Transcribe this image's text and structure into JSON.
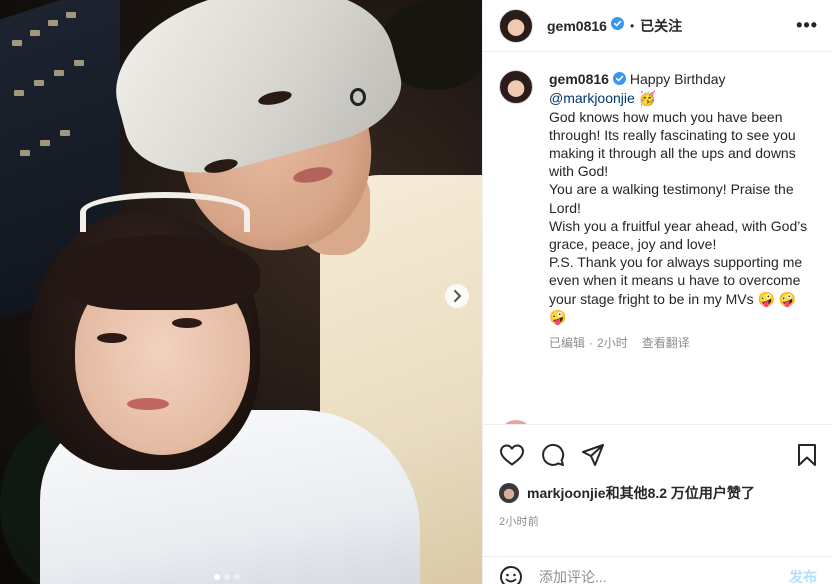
{
  "post": {
    "username": "gem0816",
    "follow_status": "已关注",
    "more_label": "•••",
    "separator": "•"
  },
  "caption": {
    "username": "gem0816",
    "intro": "Happy Birthday ",
    "mention": "@markjoonjie",
    "emoji_party": "🥳",
    "lines": [
      "God knows how much you have been through! Its really fascinating to see you making it through all the ups and downs with God!",
      "You are a walking testimony! Praise the Lord!",
      "Wish you a fruitful year ahead, with God’s grace, peace, joy and love!",
      "P.S. Thank you for always supporting me even when it means u have to overcome your stage fright to be in my MVs 🤪 🤪 🤪"
    ],
    "edited": "已编辑",
    "dot": "·",
    "time": "2小时",
    "translate": "查看翻译"
  },
  "engagement": {
    "likes_text": "markjoonjie和其他8.2 万位用户赞了",
    "timestamp": "2小时前"
  },
  "comment": {
    "placeholder": "添加评论...",
    "post_label": "发布"
  },
  "icons": {
    "verified": "verified-badge-icon",
    "heart": "heart-icon",
    "comment": "comment-icon",
    "share": "paper-plane-icon",
    "save": "bookmark-icon",
    "emoji": "smiley-icon",
    "next": "chevron-right-icon"
  },
  "colors": {
    "verified": "#3897f0",
    "mention": "#00376b",
    "post_button_disabled": "#b2dffc",
    "secondary_text": "#8e8e8e"
  },
  "carousel": {
    "slide_count": 3,
    "active_index": 0
  }
}
